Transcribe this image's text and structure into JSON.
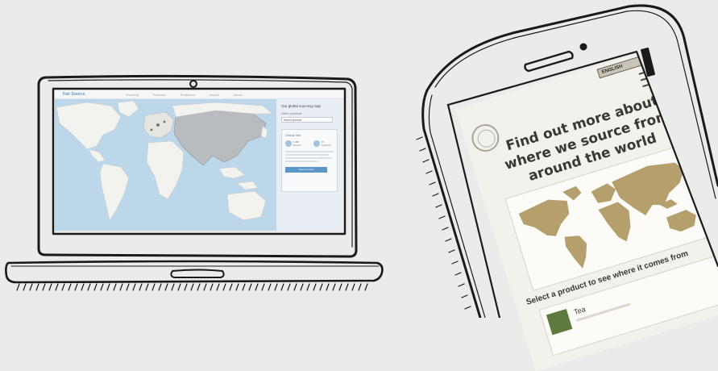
{
  "laptop": {
    "logo": "Fair Source",
    "nav": [
      "Sourcing",
      "Products",
      "Producers",
      "Impact",
      "About"
    ],
    "panel": {
      "title": "Our global sourcing map",
      "select_label": "Select a product",
      "select_value": "Select product",
      "card_title": "Global Info",
      "stat_1": "1,200 farmers",
      "stat_2": "15 countries",
      "button": "Find out more"
    }
  },
  "phone": {
    "language": "ENGLISH",
    "heading_lines": [
      "Find out more about",
      "where we source from",
      "around the world"
    ],
    "caption": "Select a product to see where it comes from",
    "product": "Tea"
  },
  "colors": {
    "background": "#ebebeb",
    "laptop_map_water": "#bcd6ea",
    "laptop_map_land": "#f2f2ee",
    "laptop_map_highlight": "#b9bcbf",
    "phone_map_land": "#b5a06d",
    "sketch_line": "#1a1a1a"
  },
  "icons": {
    "phone_menu": "hamburger-menu-icon",
    "phone_seal": "brand-seal-icon",
    "laptop_camera": "camera-dot-icon"
  }
}
